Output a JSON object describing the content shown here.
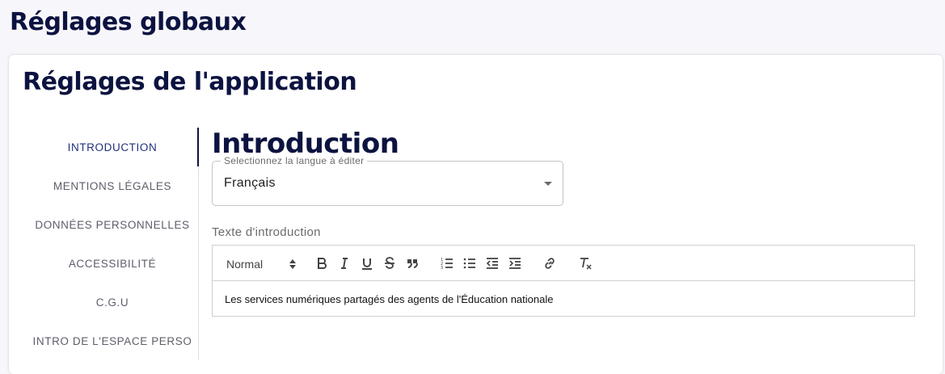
{
  "page": {
    "title": "Réglages globaux"
  },
  "card": {
    "title": "Réglages de l'application"
  },
  "sidebar": {
    "items": [
      {
        "label": "INTRODUCTION",
        "active": true
      },
      {
        "label": "MENTIONS LÉGALES",
        "active": false
      },
      {
        "label": "DONNÉES PERSONNELLES",
        "active": false
      },
      {
        "label": "ACCESSIBILITÉ",
        "active": false
      },
      {
        "label": "C.G.U",
        "active": false
      },
      {
        "label": "INTRO DE L'ESPACE PERSO",
        "active": false
      }
    ]
  },
  "section": {
    "title": "Introduction",
    "language_select": {
      "label": "Selectionnez la langue à éditer",
      "value": "Français"
    },
    "editor": {
      "label": "Texte d'introduction",
      "format_value": "Normal",
      "toolbar_icons": [
        "bold-icon",
        "italic-icon",
        "underline-icon",
        "strikethrough-icon",
        "blockquote-icon",
        "ordered-list-icon",
        "bullet-list-icon",
        "outdent-icon",
        "indent-icon",
        "link-icon",
        "clear-format-icon"
      ],
      "content": "Les services numériques partagés des agents de l'Éducation nationale"
    }
  },
  "colors": {
    "primary": "#0c1340",
    "active_nav": "#21307c",
    "muted": "#5d5d6b"
  }
}
